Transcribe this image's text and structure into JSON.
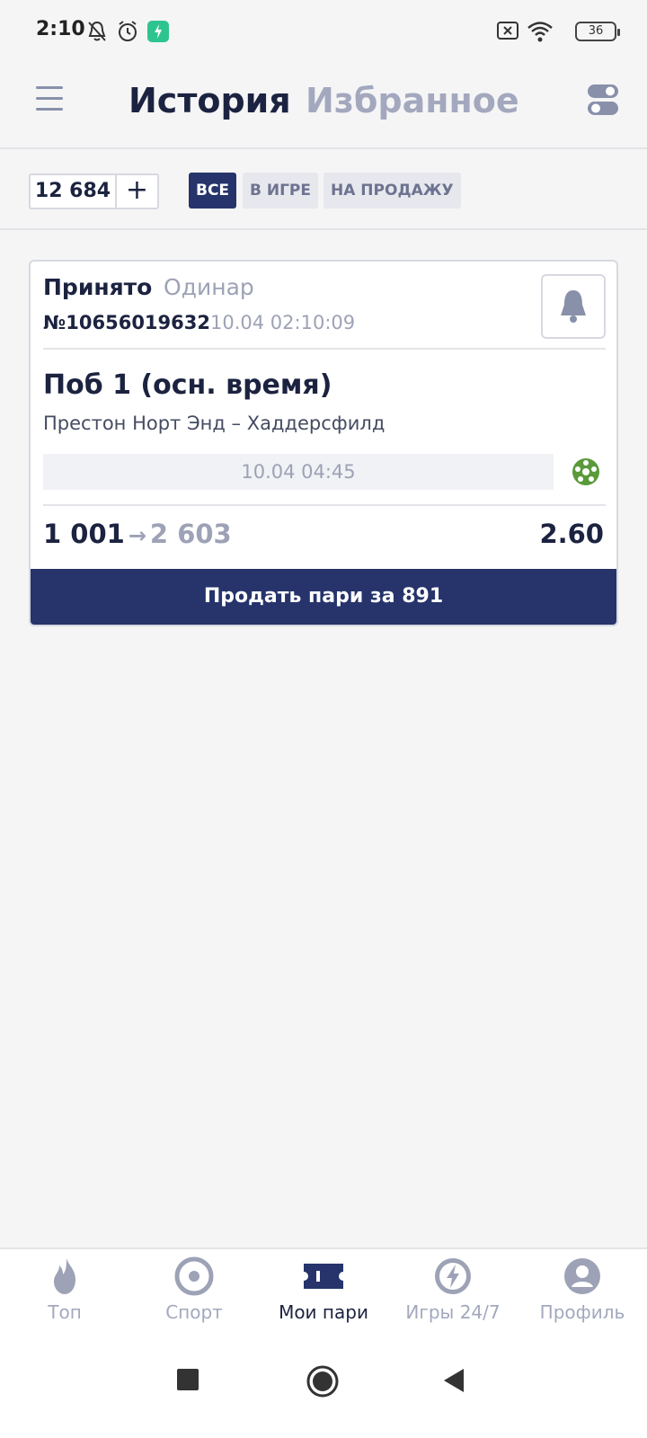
{
  "status_bar": {
    "time": "2:10",
    "battery": "36",
    "icons": [
      "bell-off-icon",
      "alarm-icon",
      "vpn-shield-icon",
      "sim-x-icon",
      "wifi-icon",
      "battery-icon"
    ]
  },
  "header": {
    "tabs": [
      {
        "label": "История",
        "active": true
      },
      {
        "label": "Избранное",
        "active": false
      }
    ],
    "menu_icon": "hamburger-icon",
    "toggle_icon": "toggle-icon"
  },
  "filters": {
    "balance": "12 684",
    "add_label": "+",
    "chips": [
      {
        "label": "ВСЕ",
        "active": true
      },
      {
        "label": "В ИГРЕ",
        "active": false
      },
      {
        "label": "НА ПРОДАЖУ",
        "active": false
      }
    ]
  },
  "bet": {
    "status": "Принято",
    "type": "Одинар",
    "number": "№10656019632",
    "placed_at": "10.04 02:10:09",
    "outcome": "Поб 1 (осн. время)",
    "match": "Престон Норт Энд – Хаддерсфилд",
    "start_time": "10.04 04:45",
    "stake": "1 001",
    "arrow": "→",
    "potential_win": "2 603",
    "odds": "2.60",
    "sell_label": "Продать пари за 891",
    "sport_icon": "football-icon",
    "notify_icon": "bell-icon"
  },
  "bottom_nav": [
    {
      "label": "Топ",
      "icon": "flame-icon",
      "active": false
    },
    {
      "label": "Спорт",
      "icon": "target-icon",
      "active": false
    },
    {
      "label": "Мои пари",
      "icon": "ticket-icon",
      "active": true
    },
    {
      "label": "Игры 24/7",
      "icon": "lightning-icon",
      "active": false
    },
    {
      "label": "Профиль",
      "icon": "user-icon",
      "active": false
    }
  ],
  "colors": {
    "primary": "#26346b",
    "text": "#1c2340",
    "muted": "#9da2b6",
    "sport_green": "#5a9a3a"
  }
}
